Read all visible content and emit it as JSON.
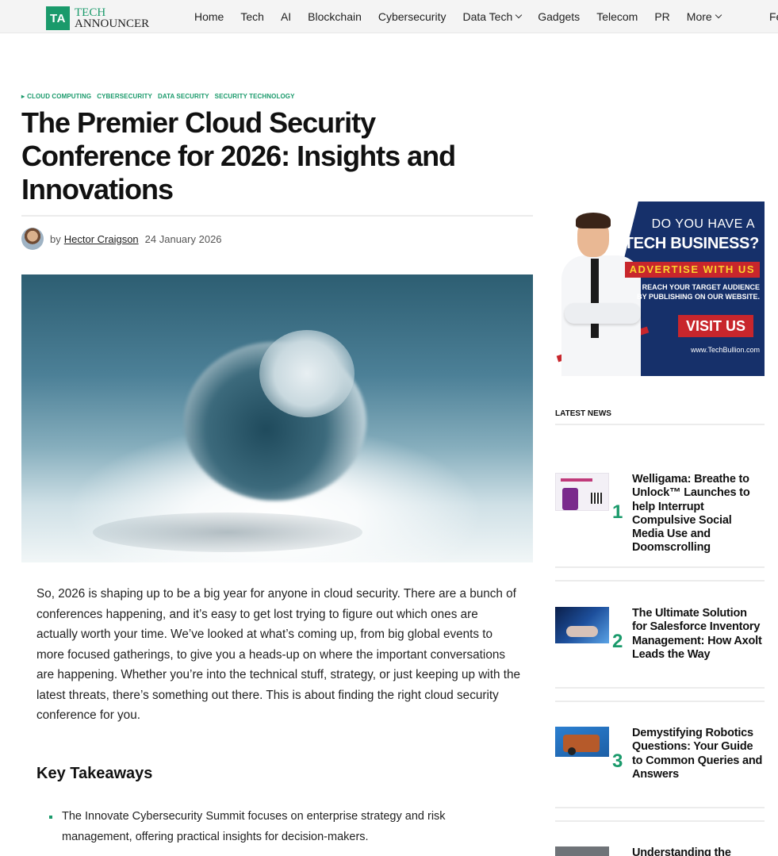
{
  "logo": {
    "mark": "TA",
    "line1": "TECH",
    "line2": "ANNOUNCER"
  },
  "nav": [
    {
      "label": "Home",
      "dropdown": false
    },
    {
      "label": "Tech",
      "dropdown": false
    },
    {
      "label": "AI",
      "dropdown": false
    },
    {
      "label": "Blockchain",
      "dropdown": false
    },
    {
      "label": "Cybersecurity",
      "dropdown": false
    },
    {
      "label": "Data Tech",
      "dropdown": true
    },
    {
      "label": "Gadgets",
      "dropdown": false
    },
    {
      "label": "Telecom",
      "dropdown": false
    },
    {
      "label": "PR",
      "dropdown": false
    },
    {
      "label": "More",
      "dropdown": true
    }
  ],
  "nav_cut": "Fe",
  "article": {
    "categories": [
      "CLOUD COMPUTING",
      "CYBERSECURITY",
      "DATA SECURITY",
      "SECURITY TECHNOLOGY"
    ],
    "category_marker": "▸",
    "title": "The Premier Cloud Security Conference for 2026: Insights and Innovations",
    "by": "by",
    "author": "Hector Craigson",
    "date": "24 January 2026",
    "intro": "So, 2026 is shaping up to be a big year for anyone in cloud security. There are a bunch of conferences happening, and it’s easy to get lost trying to figure out which ones are actually worth your time. We’ve looked at what’s coming up, from big global events to more focused gatherings, to give you a heads-up on where the important conversations are happening. Whether you’re into the technical stuff, strategy, or just keeping up with the latest threats, there’s something out there. This is about finding the right cloud security conference for you.",
    "section_heading": "Key Takeaways",
    "takeaways": [
      "The Innovate Cybersecurity Summit focuses on enterprise strategy and risk management, offering practical insights for decision-makers."
    ]
  },
  "ad": {
    "line1": "DO YOU HAVE A",
    "line2": "TECH BUSINESS?",
    "line3": "ADVERTISE WITH US",
    "line4": "REACH YOUR TARGET AUDIENCE BY PUBLISHING ON OUR WEBSITE.",
    "cta": "VISIT US",
    "url": "www.TechBullion.com"
  },
  "sidebar": {
    "title": "LATEST NEWS",
    "items": [
      {
        "num": "1",
        "title": "Welligama: Breathe to Unlock™ Launches to help Interrupt Compulsive Social Media Use and Doomscrolling"
      },
      {
        "num": "2",
        "title": "The Ultimate Solution for Salesforce Inventory Management: How Axolt Leads the Way"
      },
      {
        "num": "3",
        "title": "Demystifying Robotics Questions: Your Guide to Common Queries and Answers"
      },
      {
        "num": "",
        "title": "Understanding the"
      }
    ]
  },
  "colors": {
    "accent": "#1a9a6b",
    "ad_navy": "#16306a",
    "ad_red": "#c8262c"
  }
}
